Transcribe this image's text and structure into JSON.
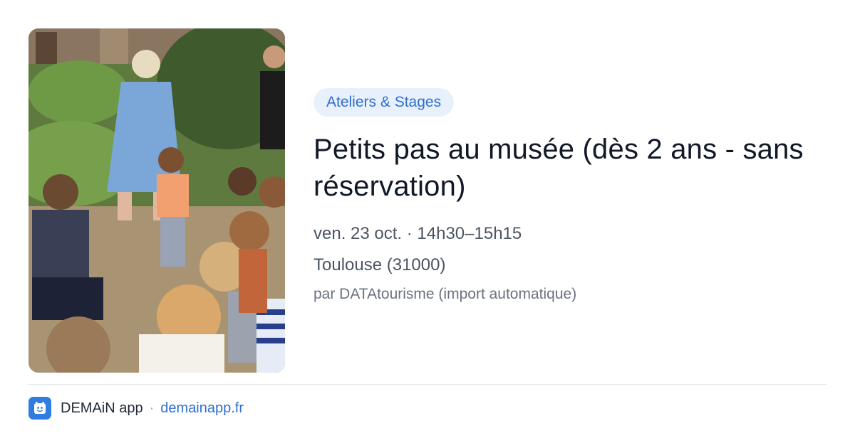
{
  "event": {
    "category": "Ateliers & Stages",
    "title": "Petits pas au musée (dès 2 ans - sans réservation)",
    "datetime": "ven. 23 oct. · 14h30–15h15",
    "location": "Toulouse (31000)",
    "source": "par DATAtourisme (import automatique)",
    "image": {
      "icon": "event-photo"
    }
  },
  "footer": {
    "app_name": "DEMAiN app",
    "separator": "·",
    "url": "demainapp.fr",
    "logo_icon": "demain-app-logo-icon"
  },
  "colors": {
    "category_bg": "#e8f0fb",
    "category_text": "#2f6fd0",
    "link": "#2f6fd0",
    "logo_bg": "#2f7de1"
  }
}
